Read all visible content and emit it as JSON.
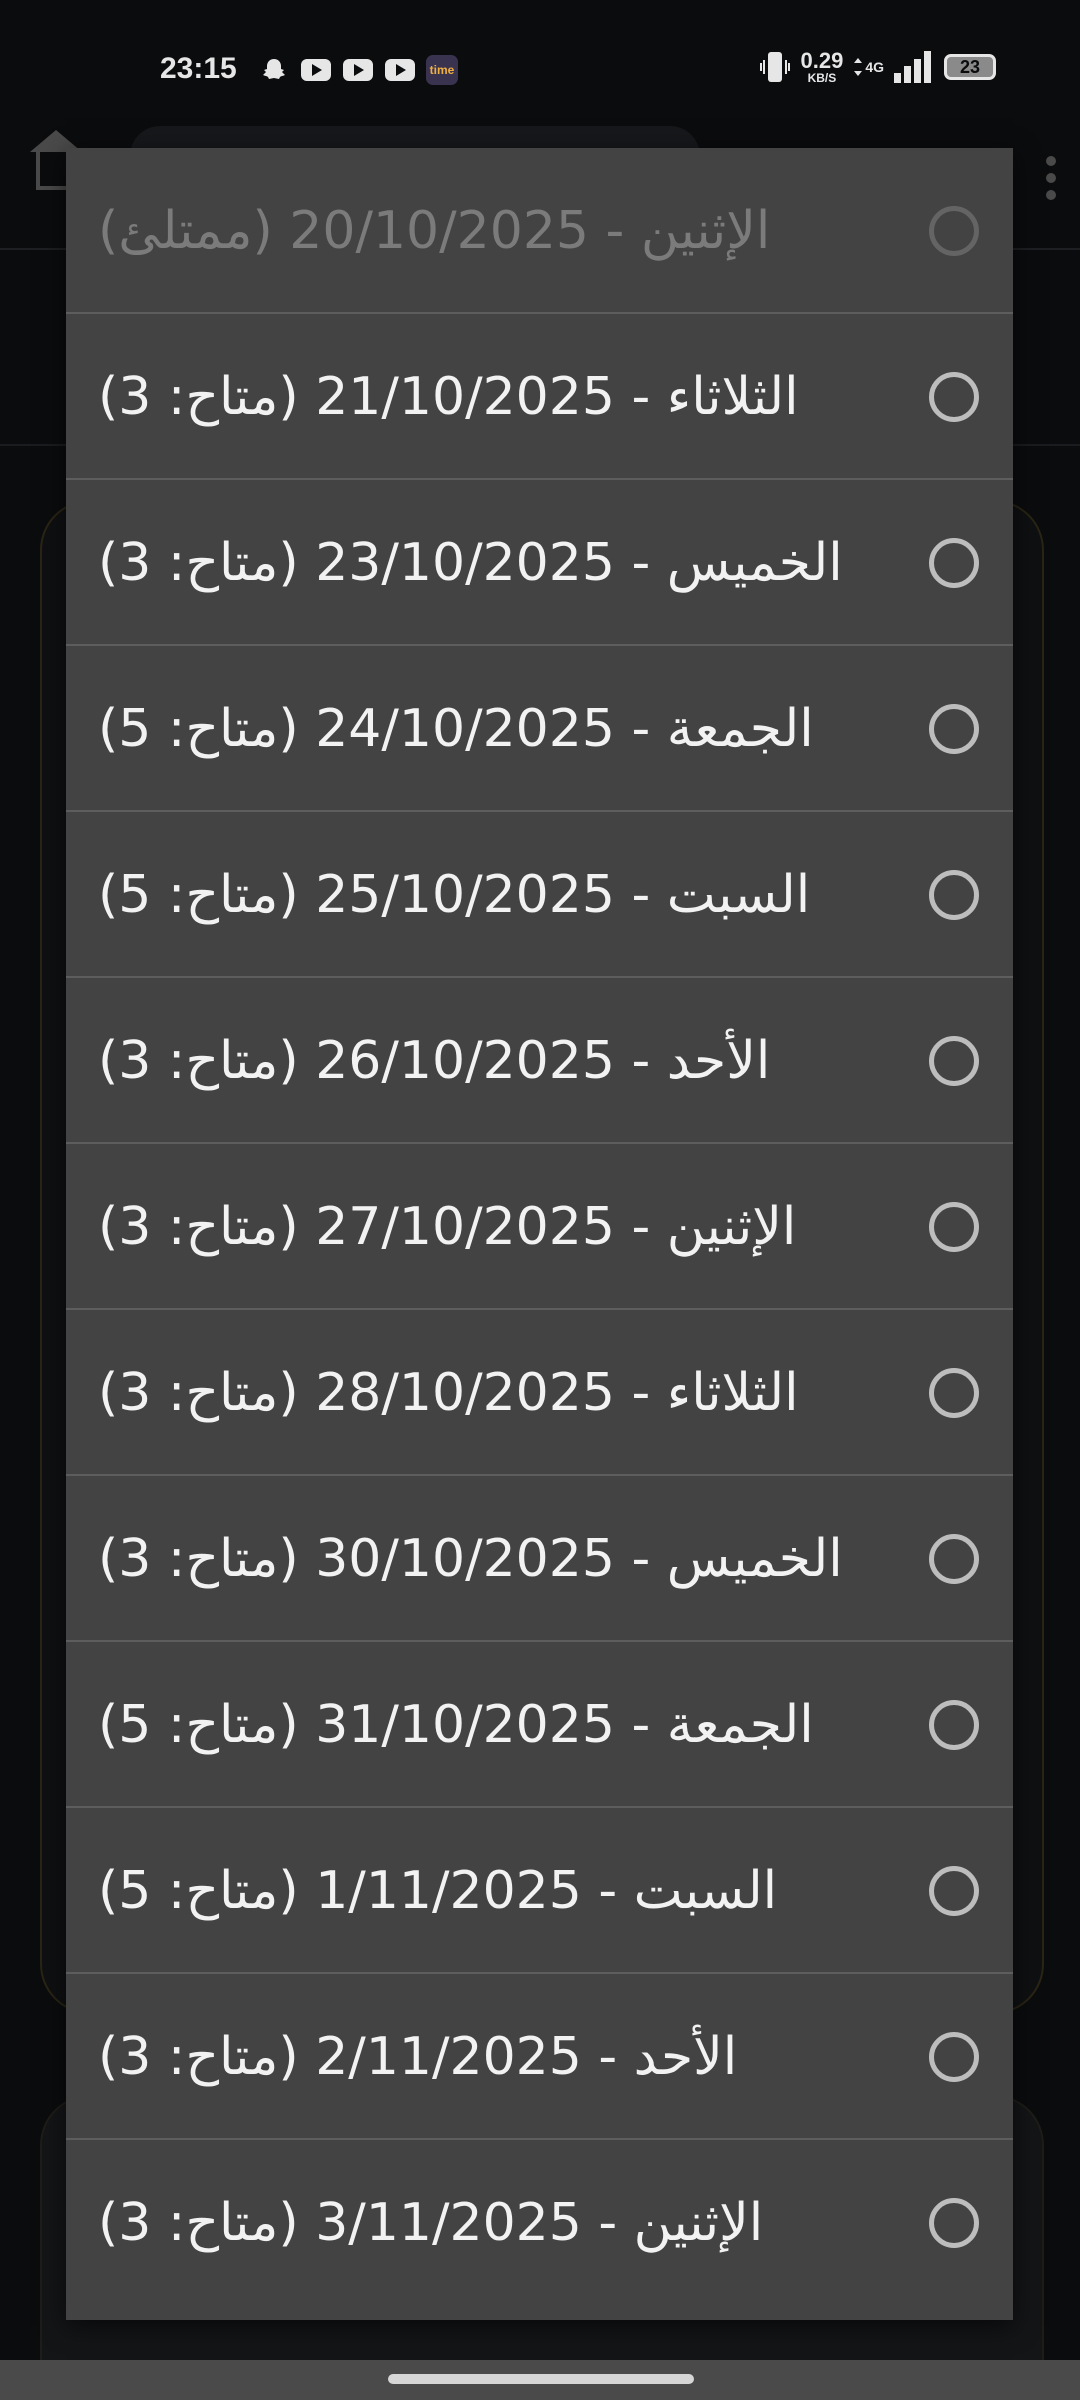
{
  "status_bar": {
    "time": "23:15",
    "notification_icons": [
      "snapchat-icon",
      "youtube-icon",
      "youtube-icon",
      "youtube-icon",
      "time-app-icon"
    ],
    "time_app_label": "time",
    "net_speed_value": "0.29",
    "net_speed_unit": "KB/S",
    "network_type": "4G",
    "battery_level": "23"
  },
  "dialog": {
    "options": [
      {
        "label": "الإثنين - 20/10/2025 (ممتلئ)",
        "enabled": false,
        "selected": false
      },
      {
        "label": "الثلاثاء - 21/10/2025 (متاح: 3)",
        "enabled": true,
        "selected": false
      },
      {
        "label": "الخميس - 23/10/2025 (متاح: 3)",
        "enabled": true,
        "selected": false
      },
      {
        "label": "الجمعة - 24/10/2025 (متاح: 5)",
        "enabled": true,
        "selected": false
      },
      {
        "label": "السبت - 25/10/2025 (متاح: 5)",
        "enabled": true,
        "selected": false
      },
      {
        "label": "الأحد - 26/10/2025 (متاح: 3)",
        "enabled": true,
        "selected": false
      },
      {
        "label": "الإثنين - 27/10/2025 (متاح: 3)",
        "enabled": true,
        "selected": false
      },
      {
        "label": "الثلاثاء - 28/10/2025 (متاح: 3)",
        "enabled": true,
        "selected": false
      },
      {
        "label": "الخميس - 30/10/2025 (متاح: 3)",
        "enabled": true,
        "selected": false
      },
      {
        "label": "الجمعة - 31/10/2025 (متاح: 5)",
        "enabled": true,
        "selected": false
      },
      {
        "label": "السبت - 1/11/2025 (متاح: 5)",
        "enabled": true,
        "selected": false
      },
      {
        "label": "الأحد - 2/11/2025 (متاح: 3)",
        "enabled": true,
        "selected": false
      },
      {
        "label": "الإثنين - 3/11/2025 (متاح: 3)",
        "enabled": true,
        "selected": false
      }
    ]
  },
  "colors": {
    "dialog_background": "#434343",
    "divider": "#5d5d5d",
    "text_enabled": "#f2f2f2",
    "text_disabled": "#7b7b7b",
    "radio_enabled": "#bdbdbd",
    "radio_disabled": "#646464",
    "screen_background": "#0b0c0e",
    "accent_gold": "#c99a2e"
  }
}
